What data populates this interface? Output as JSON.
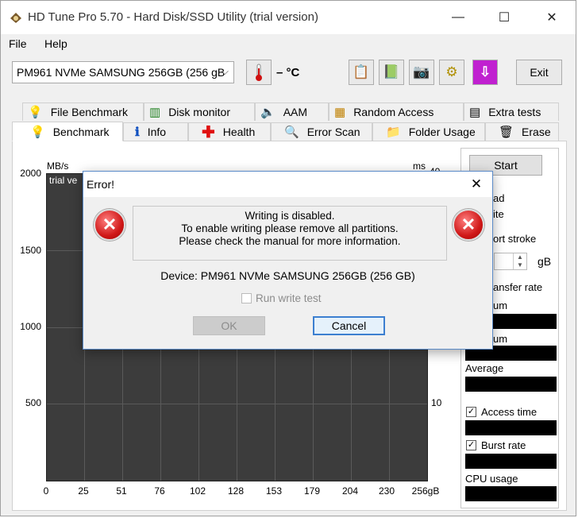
{
  "window": {
    "title": "HD Tune Pro 5.70 - Hard Disk/SSD Utility (trial version)",
    "minimize": "—",
    "maximize": "☐",
    "close": "✕"
  },
  "menu": {
    "file": "File",
    "help": "Help"
  },
  "toolbar": {
    "drive": "PM961 NVMe SAMSUNG 256GB (256 gB",
    "drive_arrow": "⌵",
    "temperature": "– °C",
    "exit": "Exit"
  },
  "tabs_top": [
    {
      "label": "File Benchmark",
      "icon": "file-benchmark-icon"
    },
    {
      "label": "Disk monitor",
      "icon": "disk-monitor-icon"
    },
    {
      "label": "AAM",
      "icon": "speaker-icon"
    },
    {
      "label": "Random Access",
      "icon": "random-access-icon"
    },
    {
      "label": "Extra tests",
      "icon": "extra-tests-icon"
    }
  ],
  "tabs_bottom": [
    {
      "label": "Benchmark",
      "icon": "bulb-icon"
    },
    {
      "label": "Info",
      "icon": "info-icon"
    },
    {
      "label": "Health",
      "icon": "health-icon"
    },
    {
      "label": "Error Scan",
      "icon": "magnifier-icon"
    },
    {
      "label": "Folder Usage",
      "icon": "folder-icon"
    },
    {
      "label": "Erase",
      "icon": "trash-icon"
    }
  ],
  "chart": {
    "y_unit": "MB/s",
    "y2_unit": "ms",
    "y2_top": "40",
    "watermark": "trial ve",
    "y_ticks": [
      "2000",
      "1500",
      "1000",
      "500"
    ],
    "y2_ticks": [
      "10"
    ],
    "x_ticks": [
      "0",
      "25",
      "51",
      "76",
      "102",
      "128",
      "153",
      "179",
      "204",
      "230",
      "256gB"
    ]
  },
  "side": {
    "start": "Start",
    "read": "ad",
    "write": "ite",
    "short_stroke": "ort stroke",
    "gb_unit": "gB",
    "transfer_rate": "ansfer rate",
    "minimum": "um",
    "maximum": "um",
    "average": "Average",
    "access_time": "Access time",
    "burst_rate": "Burst rate",
    "cpu_usage": "CPU usage"
  },
  "dialog": {
    "title": "Error!",
    "close": "✕",
    "line1": "Writing is disabled.",
    "line2": "To enable writing please remove all partitions.",
    "line3": "Please check the manual for more information.",
    "device": "Device: PM961 NVMe SAMSUNG 256GB (256 GB)",
    "run_write_test": "Run write test",
    "ok": "OK",
    "cancel": "Cancel"
  }
}
